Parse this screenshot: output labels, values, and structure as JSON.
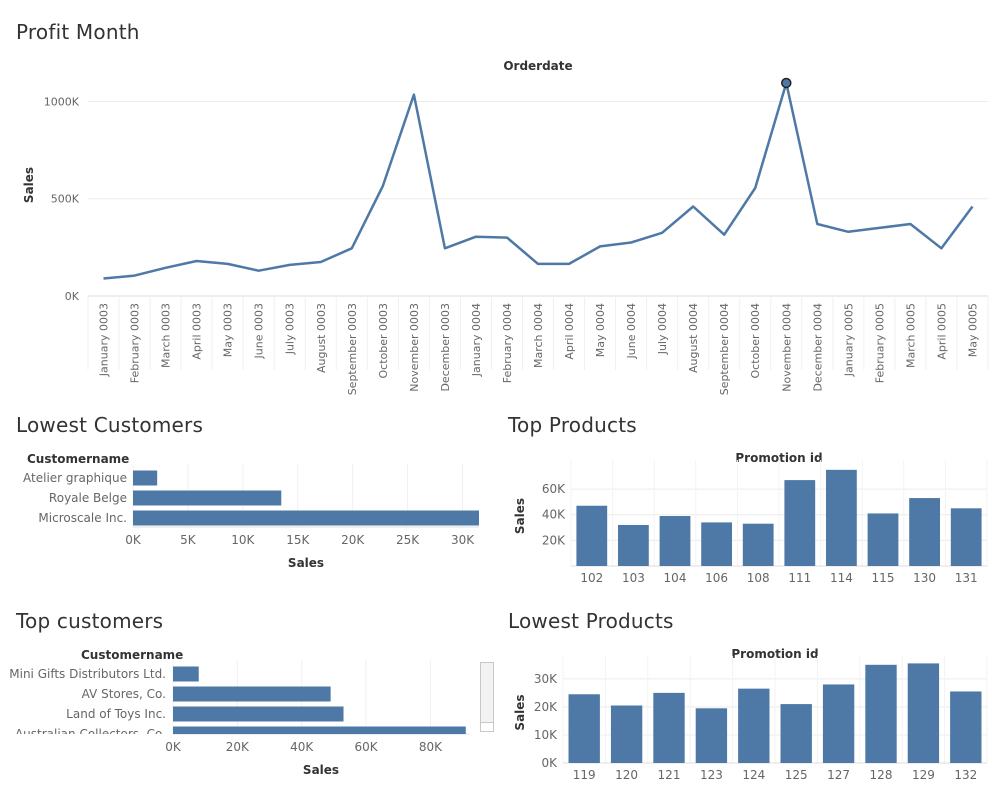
{
  "panels": {
    "profit_month": "Profit Month",
    "lowest_customers": "Lowest Customers",
    "top_products": "Top Products",
    "top_customers": "Top customers",
    "lowest_products": "Lowest Products"
  },
  "colors": {
    "bar": "#4e79a7",
    "line": "#4e79a7",
    "grid": "#ececec",
    "axis_text": "#666666"
  },
  "chart_data": [
    {
      "id": "profit_month",
      "type": "line",
      "title": "Orderdate",
      "ylabel": "Sales",
      "ylim": [
        0,
        1100000
      ],
      "yticks": [
        0,
        500000,
        1000000
      ],
      "ytick_labels": [
        "0K",
        "500K",
        "1000K"
      ],
      "grid": true,
      "highlight_index": 22,
      "categories": [
        "January 0003",
        "February 0003",
        "March 0003",
        "April 0003",
        "May 0003",
        "June 0003",
        "July 0003",
        "August 0003",
        "September 0003",
        "October 0003",
        "November 0003",
        "December 0003",
        "January 0004",
        "February 0004",
        "March 0004",
        "April 0004",
        "May 0004",
        "June 0004",
        "July 0004",
        "August 0004",
        "September 0004",
        "October 0004",
        "November 0004",
        "December 0004",
        "January 0005",
        "February 0005",
        "March 0005",
        "April 0005",
        "May 0005"
      ],
      "values": [
        90000,
        105000,
        145000,
        180000,
        165000,
        130000,
        160000,
        175000,
        245000,
        565000,
        1035000,
        245000,
        305000,
        300000,
        165000,
        165000,
        255000,
        275000,
        325000,
        460000,
        315000,
        555000,
        1095000,
        370000,
        330000,
        350000,
        370000,
        245000,
        460000
      ]
    },
    {
      "id": "lowest_customers",
      "type": "bar",
      "orientation": "horizontal",
      "header": "Customername",
      "xlabel": "Sales",
      "xlim": [
        0,
        31500
      ],
      "xticks": [
        0,
        5000,
        10000,
        15000,
        20000,
        25000,
        30000
      ],
      "xtick_labels": [
        "0K",
        "5K",
        "10K",
        "15K",
        "20K",
        "25K",
        "30K"
      ],
      "categories": [
        "Atelier graphique",
        "Royale Belge",
        "Microscale Inc."
      ],
      "values": [
        2200,
        13500,
        31500
      ]
    },
    {
      "id": "top_products",
      "type": "bar",
      "title": "Promotion id",
      "ylabel": "Sales",
      "ylim": [
        0,
        78000
      ],
      "yticks": [
        20000,
        40000,
        60000
      ],
      "ytick_labels": [
        "20K",
        "40K",
        "60K"
      ],
      "categories": [
        "102",
        "103",
        "104",
        "106",
        "108",
        "111",
        "114",
        "115",
        "130",
        "131"
      ],
      "values": [
        47000,
        32000,
        39000,
        34000,
        33000,
        67000,
        75000,
        41000,
        53000,
        45000
      ]
    },
    {
      "id": "top_customers",
      "type": "bar",
      "orientation": "horizontal",
      "header": "Customername",
      "xlabel": "Sales",
      "xlim": [
        0,
        92000
      ],
      "xticks": [
        0,
        20000,
        40000,
        60000,
        80000
      ],
      "xtick_labels": [
        "0K",
        "20K",
        "40K",
        "60K",
        "80K"
      ],
      "categories": [
        "Mini Gifts Distributors Ltd.",
        "AV Stores, Co.",
        "Land of Toys Inc.",
        "Australian Collectors, Co."
      ],
      "values": [
        8000,
        49000,
        53000,
        91000
      ]
    },
    {
      "id": "lowest_products",
      "type": "bar",
      "title": "Promotion id",
      "ylabel": "Sales",
      "ylim": [
        0,
        36000
      ],
      "yticks": [
        0,
        10000,
        20000,
        30000
      ],
      "ytick_labels": [
        "0K",
        "10K",
        "20K",
        "30K"
      ],
      "categories": [
        "119",
        "120",
        "121",
        "123",
        "124",
        "125",
        "127",
        "128",
        "129",
        "132"
      ],
      "values": [
        24500,
        20500,
        25000,
        19500,
        26500,
        21000,
        28000,
        35000,
        35500,
        25500
      ]
    }
  ]
}
